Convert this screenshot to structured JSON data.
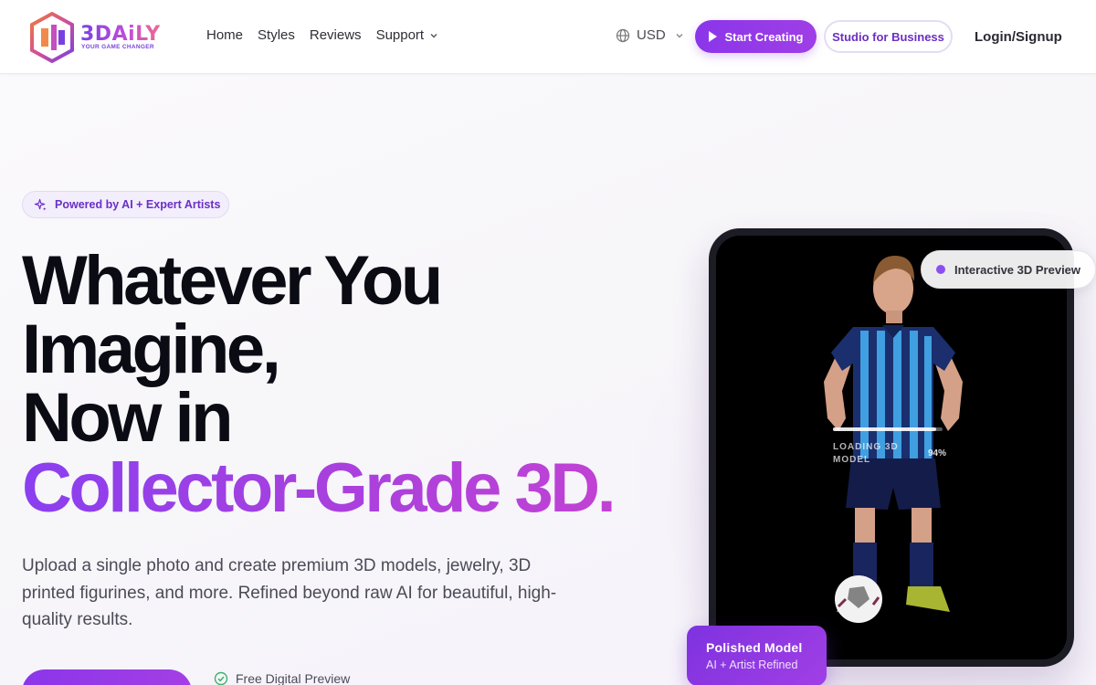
{
  "brand": {
    "name": "3DAiLY",
    "tagline": "YOUR GAME CHANGER",
    "colors": {
      "primary": "#8b35ea",
      "accent": "#c142d3",
      "logo_orange": "#f07a3a"
    }
  },
  "nav": {
    "items": [
      {
        "label": "Home"
      },
      {
        "label": "Styles"
      },
      {
        "label": "Reviews"
      },
      {
        "label": "Support",
        "has_dropdown": true
      }
    ]
  },
  "header": {
    "currency": "USD",
    "start_label": "Start Creating",
    "studio_label": "Studio for Business",
    "login_label": "Login/Signup"
  },
  "hero": {
    "badge": "Powered by AI + Expert Artists",
    "headline": [
      "Whatever You",
      "Imagine,",
      "Now in",
      "Collector-Grade 3D."
    ],
    "description": "Upload a single photo and create premium 3D models, jewelry, 3D printed figurines, and more. Refined beyond raw AI for beautiful, high-quality results.",
    "free_preview": "Free Digital Preview"
  },
  "preview": {
    "pill_label": "Interactive 3D Preview",
    "loading_label": "LOADING 3D MODEL",
    "loading_percent": 94,
    "loading_percent_text": "94%",
    "card_title": "Polished Model",
    "card_subtitle": "AI + Artist Refined"
  },
  "icons": [
    "globe-icon",
    "chevron-down-icon",
    "play-icon",
    "sparkles-icon",
    "check-circle-icon"
  ]
}
